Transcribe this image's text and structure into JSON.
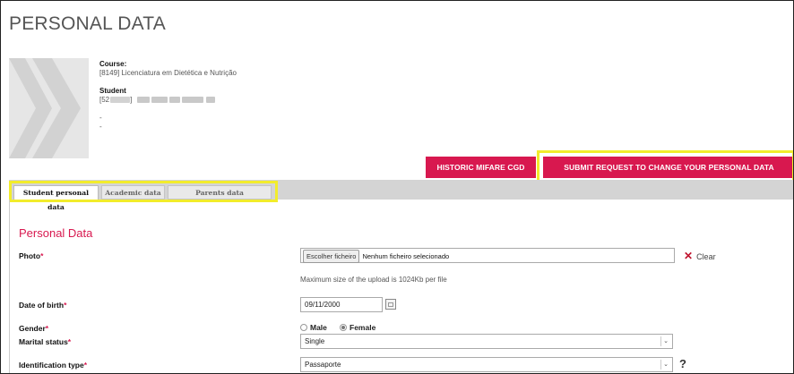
{
  "page": {
    "title": "PERSONAL DATA"
  },
  "student_card": {
    "course_label": "Course:",
    "course_value": "[8149] Licenciatura em Dietética e Nutrição",
    "student_label": "Student",
    "student_id_prefix": "[52",
    "dash1": "-",
    "dash2": "-"
  },
  "actions": {
    "historic": "HISTORIC MIFARE CGD",
    "submit": "SUBMIT REQUEST TO CHANGE YOUR PERSONAL DATA"
  },
  "tabs": [
    {
      "label": "Student personal data",
      "active": true
    },
    {
      "label": "Academic data",
      "active": false
    },
    {
      "label": "Parents data",
      "active": false
    }
  ],
  "form": {
    "section_title": "Personal Data",
    "photo_label": "Photo",
    "choose_file": "Escolher ficheiro",
    "no_file": "Nenhum ficheiro selecionado",
    "clear": "Clear",
    "upload_hint": "Maximum size of the upload is 1024Kb per file",
    "dob_label": "Date of birth",
    "dob_value": "09/11/2000",
    "gender_label": "Gender",
    "gender_options": [
      "Male",
      "Female"
    ],
    "gender_selected": "Female",
    "marital_label": "Marital status",
    "marital_value": "Single",
    "id_type_label": "Identification type",
    "id_type_value": "Passaporte",
    "required_mark": "*",
    "help": "?"
  },
  "colors": {
    "accent": "#d8184f",
    "highlight": "#f2ec2c",
    "tabbar": "#d4d4d4"
  }
}
